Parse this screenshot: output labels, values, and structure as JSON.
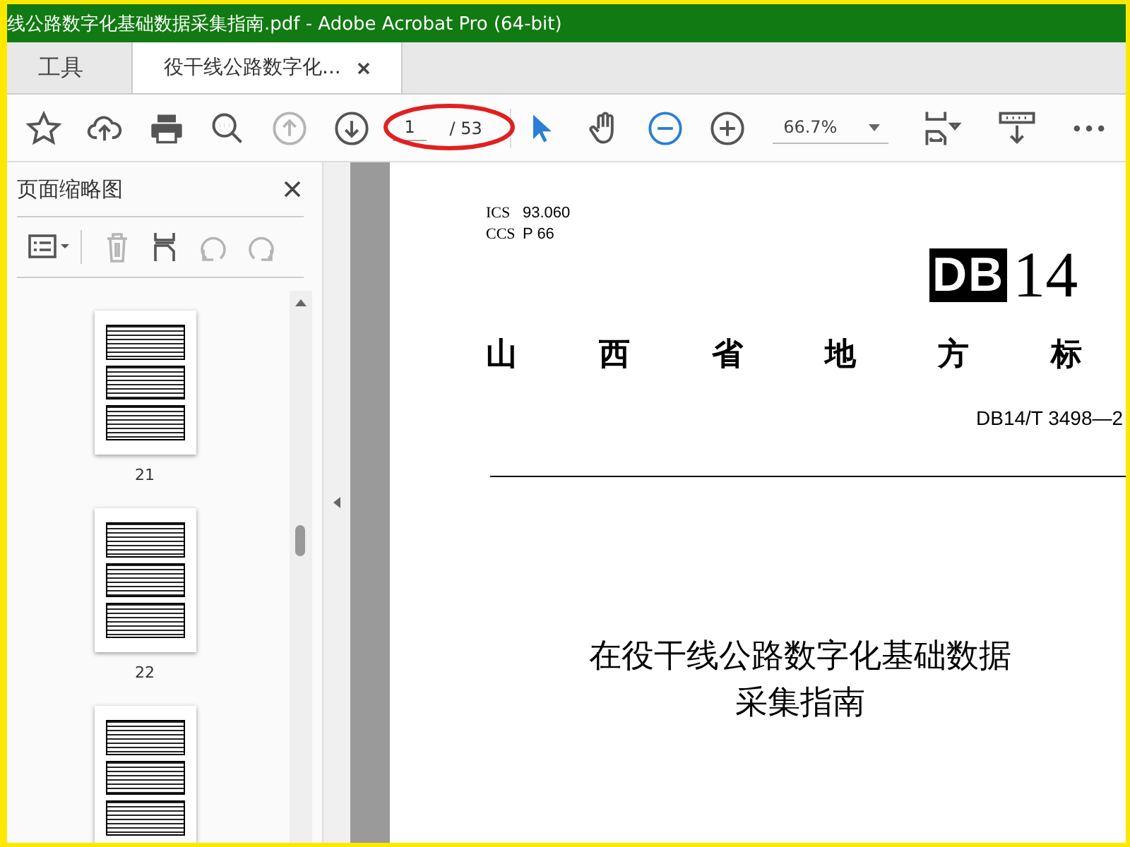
{
  "window": {
    "title": "线公路数字化基础数据采集指南.pdf - Adobe Acrobat Pro (64-bit)"
  },
  "tabs": [
    {
      "label": "工具",
      "selected": false,
      "closable": false
    },
    {
      "label": "役干线公路数字化...",
      "selected": true,
      "closable": true
    }
  ],
  "toolbar": {
    "left": [
      {
        "kind": "star",
        "disabled": false
      },
      {
        "kind": "upload",
        "disabled": false
      },
      {
        "kind": "print",
        "disabled": false
      },
      {
        "kind": "search",
        "disabled": false
      },
      {
        "kind": "prev",
        "disabled": true
      },
      {
        "kind": "next",
        "disabled": false
      }
    ],
    "page": {
      "value": "1",
      "total": "/ 53",
      "circled": true
    },
    "right": [
      {
        "kind": "cursor",
        "selected": true
      },
      {
        "kind": "hand",
        "selected": false
      },
      {
        "kind": "zoom-out",
        "selected": true
      },
      {
        "kind": "zoom-in",
        "selected": false
      }
    ],
    "zoom": "66.7%",
    "end": [
      {
        "kind": "fit"
      },
      {
        "kind": "ruler"
      },
      {
        "kind": "more"
      }
    ]
  },
  "sidebar": {
    "title": "页面缩略图",
    "tools": [
      {
        "kind": "options",
        "disabled": false
      },
      {
        "kind": "trash",
        "disabled": true
      },
      {
        "kind": "insert",
        "disabled": false
      },
      {
        "kind": "undo",
        "disabled": true
      },
      {
        "kind": "redo",
        "disabled": true
      }
    ],
    "thumbnails": [
      {
        "label": "21",
        "selected": false
      },
      {
        "label": "22",
        "selected": false
      },
      {
        "selected": false
      }
    ]
  },
  "document": {
    "meta": [
      {
        "label": "ICS",
        "value": "93.060"
      },
      {
        "label": "CCS",
        "value": "P 66"
      }
    ],
    "logo": "DB",
    "logo_number": "14",
    "heading": [
      "山",
      "西",
      "省",
      "地",
      "方",
      "标"
    ],
    "standard_number": "DB14/T  3498—2",
    "title_lines": [
      "在役干线公路数字化基础数据",
      "采集指南"
    ]
  }
}
